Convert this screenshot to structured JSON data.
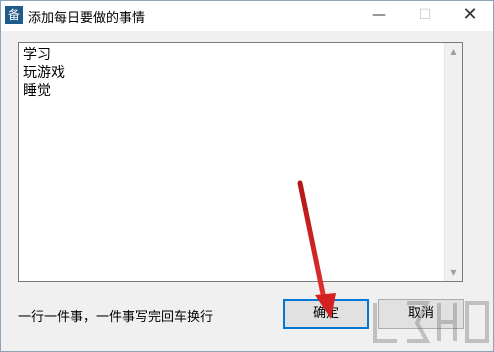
{
  "window": {
    "title": "添加每日要做的事情",
    "app_icon_glyph": "备",
    "min_glyph": "—",
    "max_glyph": "☐",
    "close_glyph": "✕"
  },
  "memo": {
    "lines": [
      "学习",
      "玩游戏",
      "睡觉"
    ]
  },
  "hint": "一行一件事，一件事写完回车换行",
  "buttons": {
    "ok_label": "确定",
    "cancel_label": "取消"
  },
  "colors": {
    "annotation_arrow": "#cc1f1f",
    "focus_border": "#0078d7"
  },
  "icons": {
    "app": "app-icon",
    "annotation": "red-arrow-annotation",
    "watermark": "watermark-logo"
  }
}
